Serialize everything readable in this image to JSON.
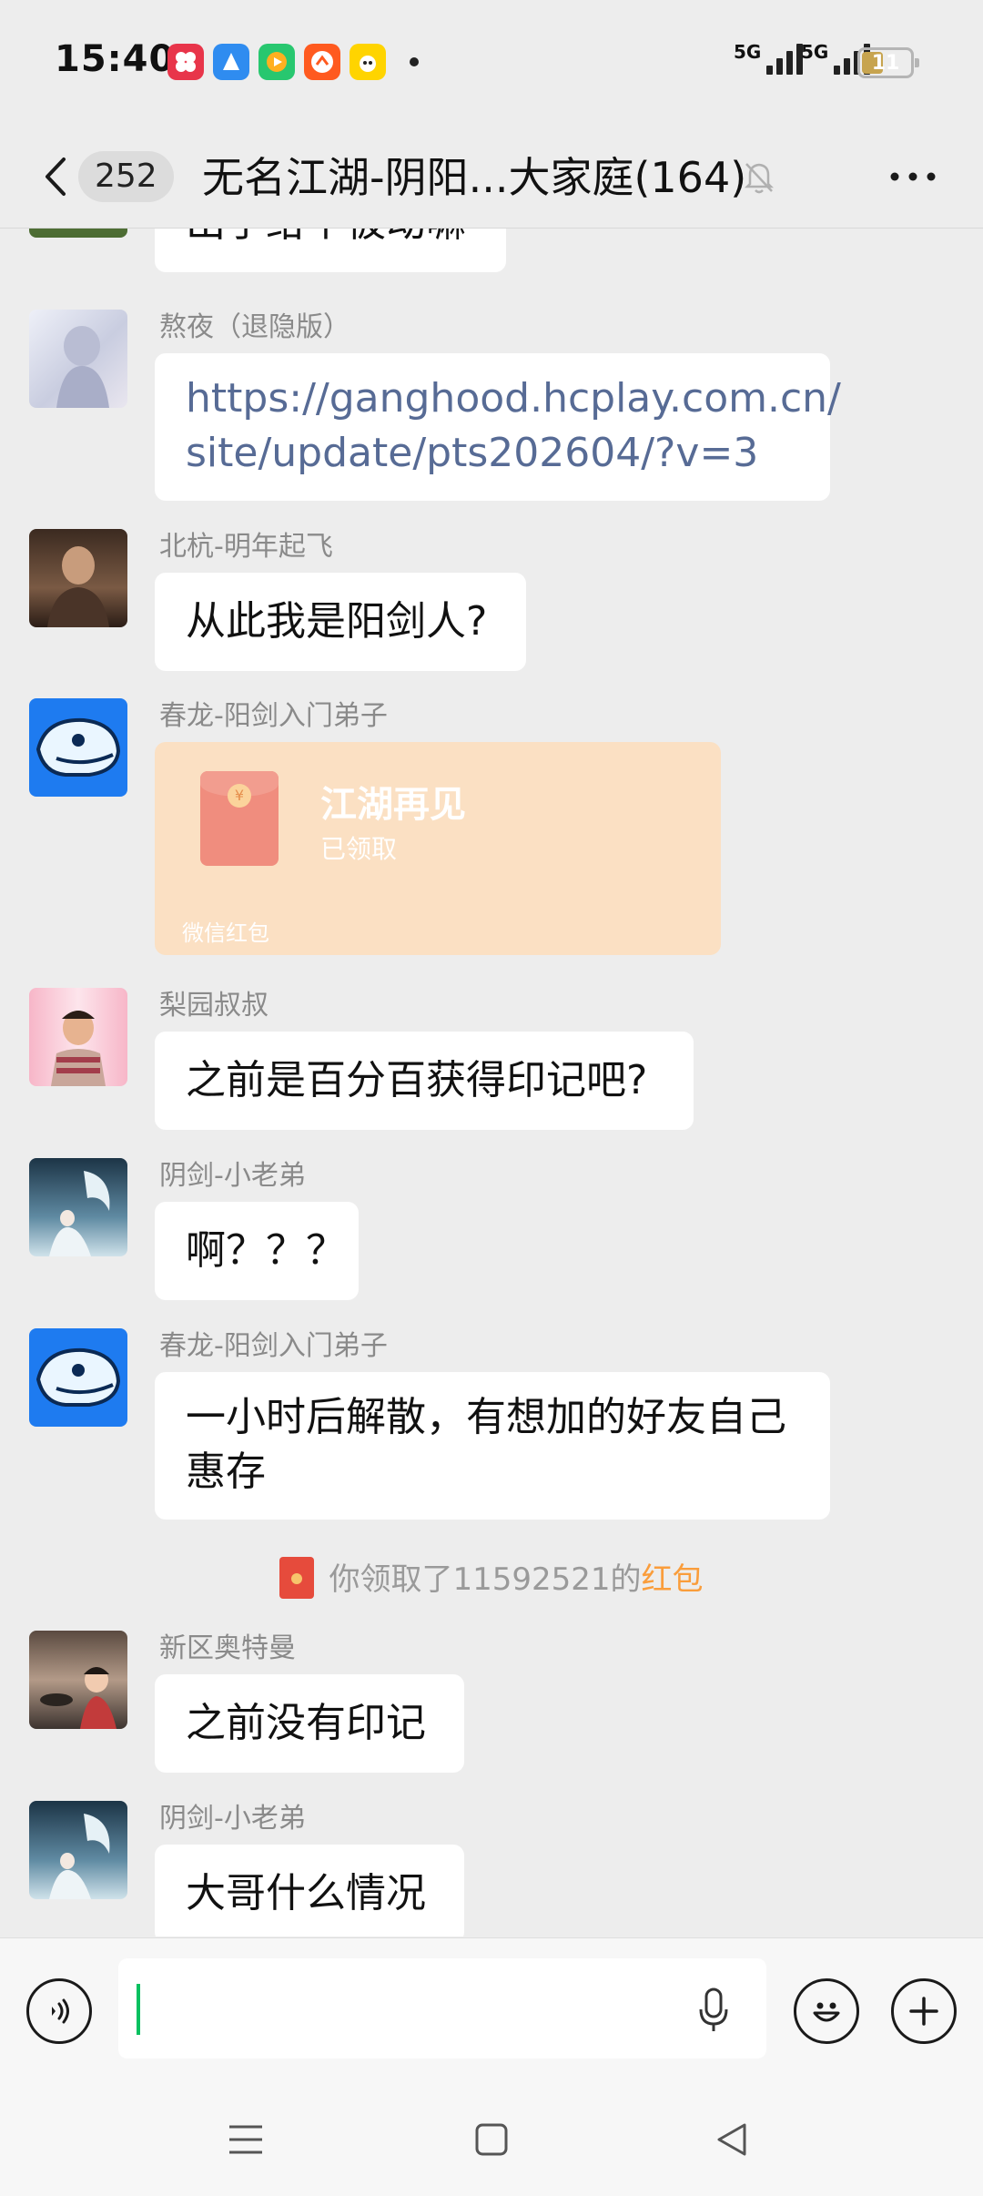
{
  "status_bar": {
    "time": "15:40",
    "net1": "5G",
    "net2": "5G",
    "battery": "11",
    "battery_level": 0.11
  },
  "header": {
    "unread_count": "252",
    "title": "无名江湖-阴阳...大家庭(164)"
  },
  "messages": [
    {
      "sender": "",
      "text": "出手给个被动嘛"
    },
    {
      "sender": "熬夜（退隐版）",
      "text_line1": "https://ganghood.hcplay.com.cn/",
      "text_line2": "site/update/pts202604/?v=3"
    },
    {
      "sender": "北杭-明年起飞",
      "text": "从此我是阳剑人?"
    },
    {
      "sender": "春龙-阳剑入门弟子",
      "red_packet": {
        "title": "江湖再见",
        "status": "已领取",
        "footer": "微信红包"
      }
    },
    {
      "sender": "梨园叔叔",
      "text": "之前是百分百获得印记吧?"
    },
    {
      "sender": "阴剑-小老弟",
      "text": "啊？？？"
    },
    {
      "sender": "春龙-阳剑入门弟子",
      "text_line1": "一小时后解散，有想加的好友自己",
      "text_line2": "惠存"
    },
    {
      "system": {
        "prefix": "你领取了11592521的",
        "highlight": "红包"
      }
    },
    {
      "sender": "新区奥特曼",
      "text": "之前没有印记"
    },
    {
      "sender": "阴剑-小老弟",
      "text": "大哥什么情况"
    }
  ],
  "colors": {
    "link": "#576b95",
    "red_packet_bg": "#fbe0c3",
    "caret": "#07c160",
    "highlight": "#fa9d3b"
  },
  "icons": [
    "back-chevron-icon",
    "mute-bell-icon",
    "more-dots-icon",
    "voice-icon",
    "microphone-icon",
    "emoji-icon",
    "plus-icon",
    "menu-icon",
    "home-square-icon",
    "back-triangle-icon"
  ]
}
